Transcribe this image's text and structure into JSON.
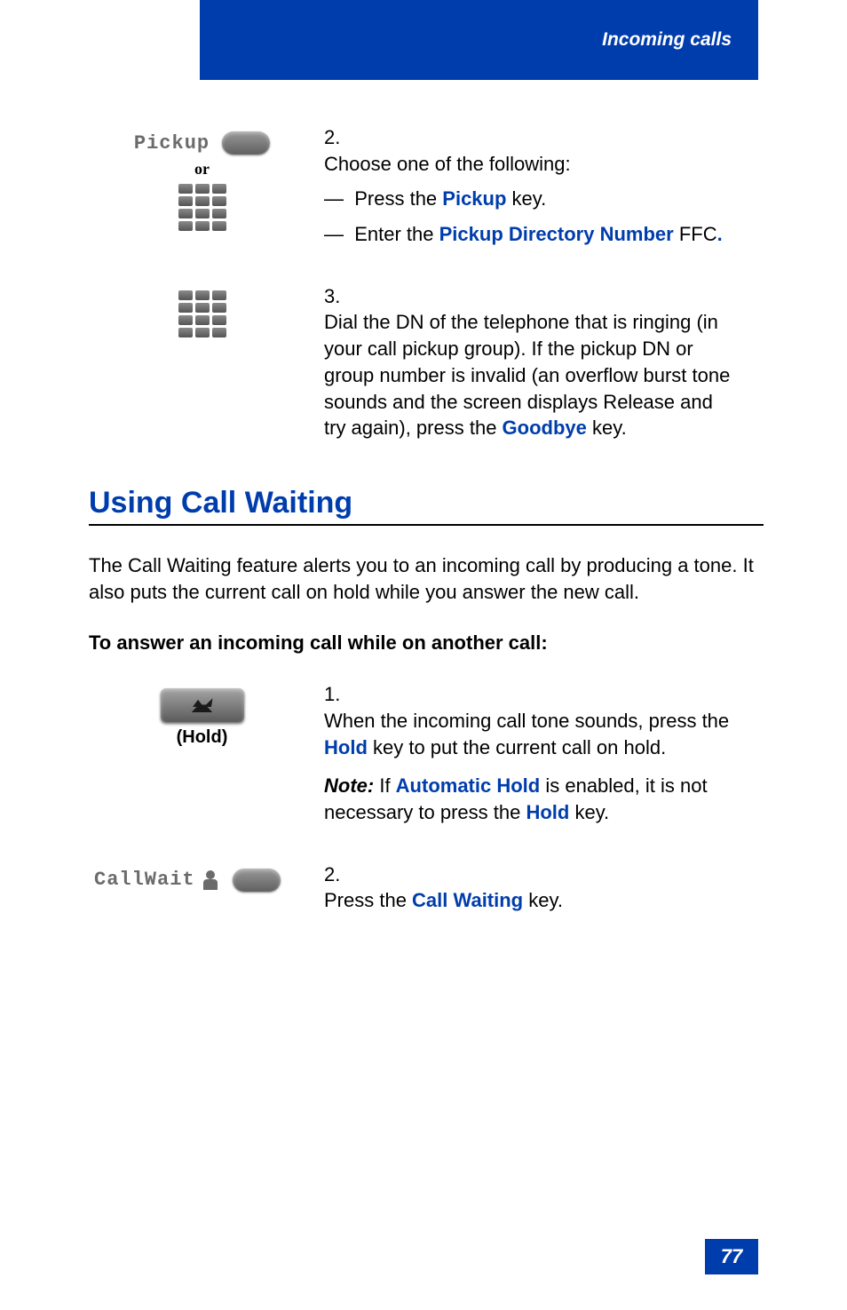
{
  "header": {
    "title": "Incoming calls"
  },
  "step2": {
    "num": "2.",
    "lead": "Choose one of the following:",
    "optA_pre": "Press the ",
    "optA_key": "Pickup",
    "optA_post": " key.",
    "optB_pre": "Enter the ",
    "optB_key": "Pickup Directory Number",
    "optB_post": " FFC",
    "optB_dot": ".",
    "pickup_label": "Pickup",
    "or_label": "or"
  },
  "step3": {
    "num": "3.",
    "body_pre": "Dial the DN of the telephone that is ringing (in your call pickup group). If the pickup DN or group number is invalid (an overflow burst tone sounds and the screen displays Release and try again), press the ",
    "body_key": "Goodbye",
    "body_post": " key."
  },
  "section": {
    "heading": "Using Call Waiting",
    "intro": "The Call Waiting feature alerts you to an incoming call by producing a tone. It also puts the current call on hold while you answer the new call.",
    "lead": "To answer an incoming call while on another call:"
  },
  "cw_step1": {
    "num": "1.",
    "pre": "When the incoming call tone sounds, press the ",
    "key1": "Hold",
    "mid": " key to put the current call on hold.",
    "note_label": "Note:",
    "note_pre": " If ",
    "note_key": "Automatic Hold",
    "note_mid": " is enabled, it is not necessary to press the ",
    "note_key2": "Hold",
    "note_post": " key.",
    "hold_caption": "(Hold)"
  },
  "cw_step2": {
    "num": "2.",
    "pre": "Press the ",
    "key": "Call Waiting",
    "post": " key.",
    "callwait_label": "CallWait"
  },
  "page_number": "77"
}
